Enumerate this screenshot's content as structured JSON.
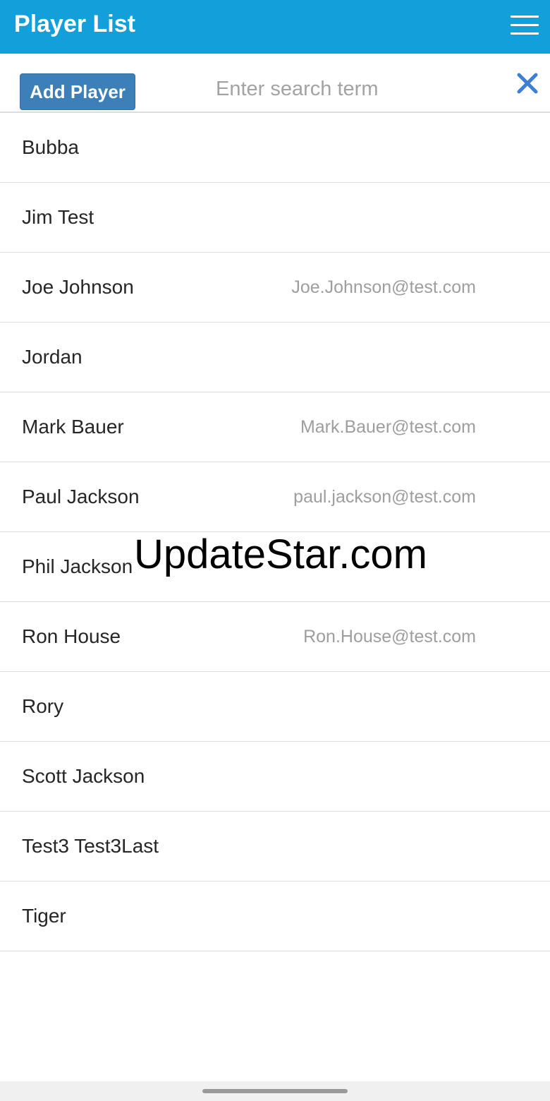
{
  "app_bar": {
    "title": "Player List",
    "menu_icon": "hamburger-menu-icon",
    "background": "#129fda"
  },
  "toolbar": {
    "add_label": "Add Player",
    "search_placeholder": "Enter search term",
    "search_value": "",
    "clear_icon": "close-icon",
    "accent": "#3d7fb8"
  },
  "players": [
    {
      "name": "Bubba",
      "email": ""
    },
    {
      "name": "Jim Test",
      "email": ""
    },
    {
      "name": "Joe Johnson",
      "email": "Joe.Johnson@test.com"
    },
    {
      "name": "Jordan",
      "email": ""
    },
    {
      "name": "Mark Bauer",
      "email": "Mark.Bauer@test.com"
    },
    {
      "name": "Paul Jackson",
      "email": "paul.jackson@test.com"
    },
    {
      "name": "Phil Jackson",
      "email": ""
    },
    {
      "name": "Ron House",
      "email": "Ron.House@test.com"
    },
    {
      "name": "Rory",
      "email": ""
    },
    {
      "name": "Scott Jackson",
      "email": ""
    },
    {
      "name": "Test3 Test3Last",
      "email": ""
    },
    {
      "name": "Tiger",
      "email": ""
    }
  ],
  "watermark": "UpdateStar.com"
}
